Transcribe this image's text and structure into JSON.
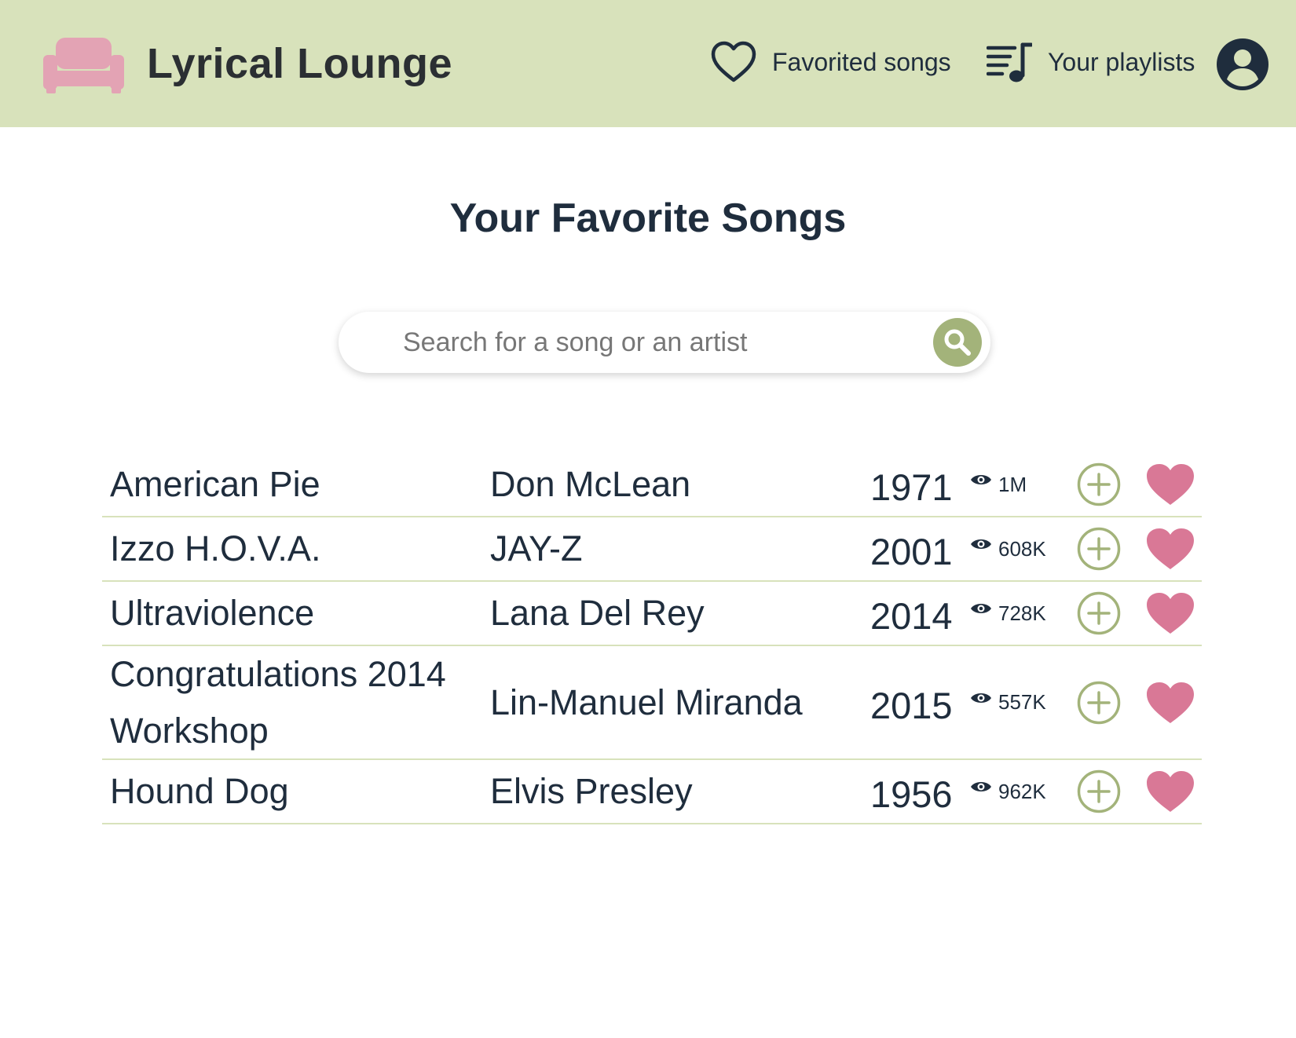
{
  "app": {
    "name": "Lyrical Lounge",
    "brand_color": "#e3a3b4",
    "nav_bg_color": "#d8e2bb",
    "accent_color": "#a3b37a",
    "heart_color": "#d97896"
  },
  "nav": {
    "favorited_label": "Favorited songs",
    "playlists_label": "Your playlists",
    "icons": [
      "sofa-icon",
      "heart-outline-icon",
      "playlist-icon",
      "user-circle-icon"
    ]
  },
  "main": {
    "title": "Your Favorite Songs",
    "search": {
      "placeholder": "Search for a song or an artist",
      "value": "",
      "button_icon": "search-icon"
    }
  },
  "songs": [
    {
      "title": "American Pie",
      "artist": "Don McLean",
      "year": "1971",
      "views": "1M",
      "favorited": true
    },
    {
      "title": "Izzo H.O.V.A.",
      "artist": "JAY-Z",
      "year": "2001",
      "views": "608K",
      "favorited": true
    },
    {
      "title": "Ultraviolence",
      "artist": "Lana Del Rey",
      "year": "2014",
      "views": "728K",
      "favorited": true
    },
    {
      "title": "Congratulations 2014 Workshop",
      "artist": "Lin-Manuel Miranda",
      "year": "2015",
      "views": "557K",
      "favorited": true
    },
    {
      "title": "Hound Dog",
      "artist": "Elvis Presley",
      "year": "1956",
      "views": "962K",
      "favorited": true
    }
  ]
}
